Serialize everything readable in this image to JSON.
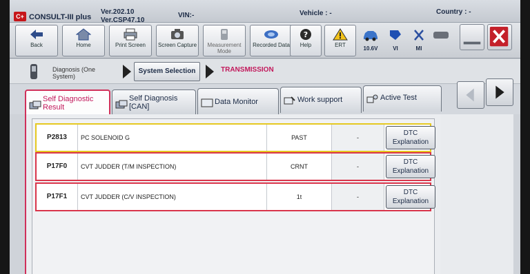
{
  "titlebar": {
    "logo": "C+",
    "app_name": "CONSULT-III plus",
    "version": "Ver.202.10",
    "csp_version": "Ver.CSP47.10",
    "vin": "VIN:-",
    "vehicle": "Vehicle : -",
    "country": "Country : -"
  },
  "toolbar": {
    "back": "Back",
    "home": "Home",
    "print_screen": "Print Screen",
    "screen_capture": "Screen Capture",
    "measurement_mode": "Measurement Mode",
    "recorded_data": "Recorded Data",
    "help": "Help",
    "ert": "ERT",
    "voltage": "10.6V",
    "vi": "VI",
    "mi": "MI"
  },
  "breadcrumb": {
    "step1": "Diagnosis (One System)",
    "step2": "System Selection",
    "step3": "TRANSMISSION"
  },
  "tabs": [
    {
      "label": "Self Diagnostic Result"
    },
    {
      "label": "Self Diagnosis [CAN]"
    },
    {
      "label": "Data Monitor"
    },
    {
      "label": "Work support"
    },
    {
      "label": "Active Test"
    }
  ],
  "dtc_rows": [
    {
      "code": "P2813",
      "description": "PC SOLENOID G",
      "status": "PAST",
      "extra": "-",
      "button": "DTC Explanation"
    },
    {
      "code": "P17F0",
      "description": "CVT JUDDER (T/M INSPECTION)",
      "status": "CRNT",
      "extra": "-",
      "button": "DTC Explanation"
    },
    {
      "code": "P17F1",
      "description": "CVT JUDDER (C/V INSPECTION)",
      "status": "1t",
      "extra": "-",
      "button": "DTC Explanation"
    }
  ],
  "colors": {
    "accent": "#c2185b",
    "past_border": "#e5c820",
    "current_border": "#d9344a"
  }
}
